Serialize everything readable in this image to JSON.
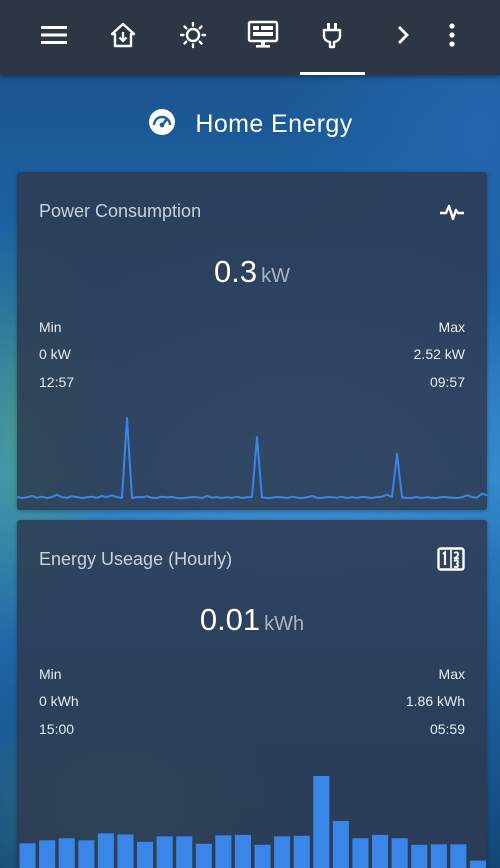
{
  "toolbar": {
    "icons": [
      "menu-icon",
      "home-icon",
      "brightness-icon",
      "monitor-icon",
      "plug-icon",
      "chevron-right-icon",
      "more-vertical-icon"
    ],
    "active_tab": "plug-icon"
  },
  "page": {
    "title": "Home Energy",
    "icon": "gauge-icon"
  },
  "power_card": {
    "title": "Power Consumption",
    "icon": "pulse-icon",
    "value": "0.3",
    "unit": "kW",
    "min_label": "Min",
    "max_label": "Max",
    "min_value": "0 kW",
    "max_value": "2.52 kW",
    "min_time": "12:57",
    "max_time": "09:57"
  },
  "energy_card": {
    "title": "Energy Useage (Hourly)",
    "icon": "numeric-icon",
    "value": "0.01",
    "unit": "kWh",
    "min_label": "Min",
    "max_label": "Max",
    "min_value": "0 kWh",
    "max_value": "1.86 kWh",
    "min_time": "15:00",
    "max_time": "05:59"
  },
  "colors": {
    "accent": "#3a86e8",
    "card_bg": "#2e3a50",
    "topbar_bg": "#2c3645"
  },
  "chart_data": [
    {
      "type": "line",
      "ylim": [
        0,
        2.52
      ],
      "values": [
        0.15,
        0.12,
        0.14,
        0.18,
        0.13,
        0.16,
        0.12,
        0.15,
        0.22,
        0.14,
        0.13,
        0.17,
        0.15,
        0.12,
        0.14,
        0.16,
        0.13,
        0.18,
        0.15,
        0.2,
        0.14,
        0.13,
        2.52,
        0.12,
        0.15,
        0.14,
        0.17,
        0.13,
        0.12,
        0.16,
        0.14,
        0.15,
        0.12,
        0.11,
        0.13,
        0.15,
        0.14,
        0.12,
        0.18,
        0.13,
        0.15,
        0.12,
        0.14,
        0.13,
        0.16,
        0.12,
        0.14,
        0.15,
        1.95,
        0.14,
        0.12,
        0.13,
        0.15,
        0.14,
        0.12,
        0.16,
        0.13,
        0.12,
        0.14,
        0.18,
        0.13,
        0.12,
        0.15,
        0.14,
        0.13,
        0.16,
        0.12,
        0.14,
        0.13,
        0.15,
        0.14,
        0.12,
        0.15,
        0.16,
        0.22,
        0.15,
        1.45,
        0.14,
        0.12,
        0.13,
        0.15,
        0.12,
        0.14,
        0.13,
        0.12,
        0.15,
        0.14,
        0.13,
        0.12,
        0.14,
        0.2,
        0.15,
        0.13,
        0.25,
        0.2
      ]
    },
    {
      "type": "bar",
      "ylim": [
        0,
        1.86
      ],
      "values": [
        0.5,
        0.56,
        0.6,
        0.56,
        0.7,
        0.68,
        0.53,
        0.64,
        0.64,
        0.49,
        0.66,
        0.67,
        0.47,
        0.64,
        0.65,
        1.86,
        0.95,
        0.6,
        0.67,
        0.6,
        0.47,
        0.48,
        0.48,
        0.15
      ]
    }
  ]
}
